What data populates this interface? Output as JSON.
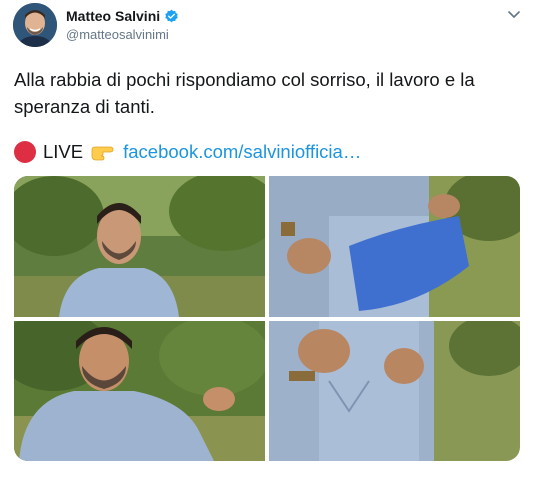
{
  "author": {
    "display_name": "Matteo Salvini",
    "handle": "@matteosalvinimi",
    "verified": true,
    "avatar_icon": "profile-photo"
  },
  "tweet": {
    "text": "Alla rabbia di pochi rispondiamo col sorriso, il lavoro e la speranza di tanti.",
    "live_label": "LIVE",
    "link_text": "facebook.com/salviniofficia…",
    "emoji_1": "red-circle-icon",
    "emoji_2": "pointing-right-hand-icon"
  },
  "media": {
    "photo_count": 4
  },
  "colors": {
    "link": "#1b95e0",
    "verified_badge": "#1da1f2",
    "secondary_text": "#657786",
    "red_circle": "#dd2e44"
  }
}
